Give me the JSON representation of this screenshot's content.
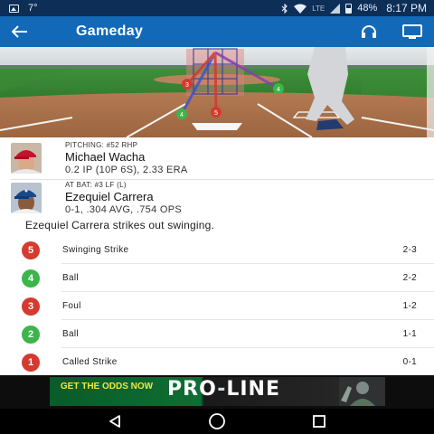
{
  "status_bar": {
    "notification_temp": "7°",
    "network": "LTE",
    "battery": "48%",
    "time": "8:17 PM",
    "icons": [
      "image-icon",
      "bluetooth-icon",
      "wifi-icon",
      "signal-icon",
      "battery-icon"
    ]
  },
  "app_bar": {
    "title": "Gameday",
    "icons": [
      "back-arrow-icon",
      "headphones-icon",
      "tv-icon"
    ]
  },
  "field": {
    "zone_color": "#e07f7f",
    "pitch_markers": [
      {
        "number": "3",
        "type": "Foul",
        "color": "#d43a2f"
      },
      {
        "number": "4",
        "type": "Ball",
        "color": "#3cb54a"
      },
      {
        "number": "5",
        "type": "Swinging Strike",
        "color": "#d43a2f"
      },
      {
        "number": "4",
        "type": "Ball",
        "color": "#3cb54a"
      }
    ]
  },
  "pitcher": {
    "role": "PITCHING: #52 RHP",
    "name": "Michael Wacha",
    "stats": "0.2 IP (10P 6S), 2.33 ERA",
    "cap_color": "#c8102e"
  },
  "batter": {
    "role": "AT BAT: #3 LF (L)",
    "name": "Ezequiel Carrera",
    "stats": "0-1, .304 AVG, .754 OPS",
    "cap_color": "#134a8e"
  },
  "summary": "Ezequiel Carrera strikes out swinging.",
  "pitches": [
    {
      "number": "5",
      "description": "Swinging Strike",
      "count": "2-3",
      "color": "#d43a2f"
    },
    {
      "number": "4",
      "description": "Ball",
      "count": "2-2",
      "color": "#3cb54a"
    },
    {
      "number": "3",
      "description": "Foul",
      "count": "1-2",
      "color": "#d43a2f"
    },
    {
      "number": "2",
      "description": "Ball",
      "count": "1-1",
      "color": "#3cb54a"
    },
    {
      "number": "1",
      "description": "Called Strike",
      "count": "0-1",
      "color": "#d43a2f"
    }
  ],
  "ad": {
    "cta": "GET THE ODDS NOW",
    "brand_a": "PRO",
    "brand_dash": "-",
    "brand_b": "LINE"
  },
  "nav_bar": {
    "icons": [
      "back-triangle-icon",
      "home-circle-icon",
      "recents-square-icon"
    ]
  }
}
